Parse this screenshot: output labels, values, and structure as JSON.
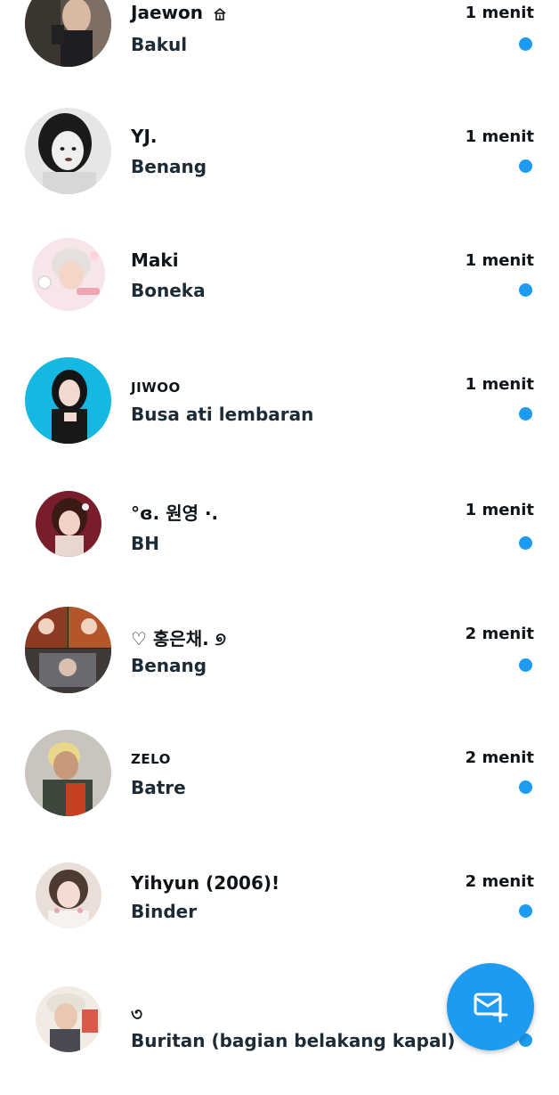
{
  "colors": {
    "accent": "#1d9bf0",
    "text_primary": "#0f1419",
    "text_preview": "#1d2b36"
  },
  "conversations": [
    {
      "name": "Jaewon",
      "name_icon": "house-icon",
      "preview": "Bakul",
      "time": "1 menit",
      "unread": true
    },
    {
      "name": "YJ.",
      "preview": "Benang",
      "time": "1 menit",
      "unread": true
    },
    {
      "name": "Maki",
      "preview": "Boneka",
      "time": "1 menit",
      "unread": true
    },
    {
      "name": "JIWOO",
      "preview": "Busa ati lembaran",
      "time": "1 menit",
      "unread": true
    },
    {
      "name": "°ɞ. 원영 ·.",
      "preview": "BH",
      "time": "1 menit",
      "unread": true
    },
    {
      "name": "♡ 홍은채. ୭",
      "preview": "Benang",
      "time": "2 menit",
      "unread": true
    },
    {
      "name": "ZELO",
      "preview": "Batre",
      "time": "2 menit",
      "unread": true
    },
    {
      "name": "Yihyun (2006)!",
      "preview": "Binder",
      "time": "2 menit",
      "unread": true
    },
    {
      "name": "৩",
      "preview": "Buritan (bagian belakang kapal)",
      "time": "",
      "unread": true
    }
  ],
  "fab": {
    "icon": "new-message-icon"
  }
}
